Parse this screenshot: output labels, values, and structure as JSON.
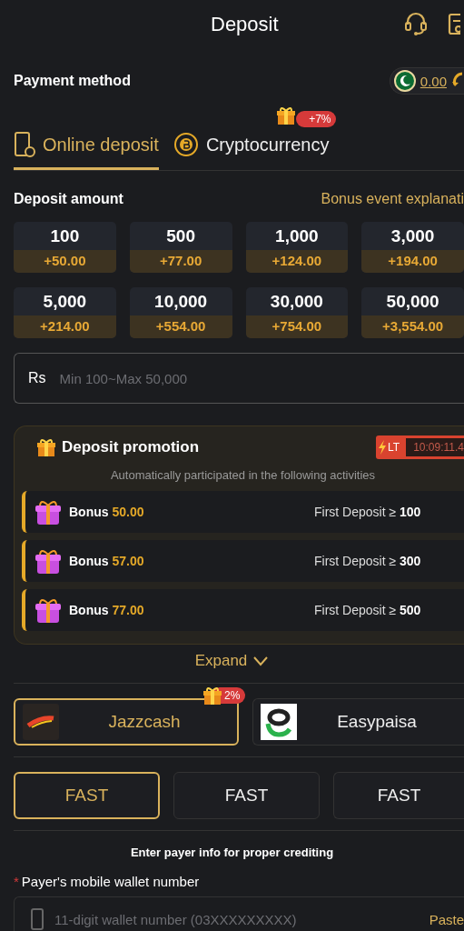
{
  "header": {
    "title": "Deposit"
  },
  "payment_method": {
    "label": "Payment method",
    "balance": "0.00"
  },
  "tabs": [
    {
      "label": "Online deposit",
      "selected": true,
      "kind": "phone"
    },
    {
      "label": "Cryptocurrency",
      "selected": false,
      "kind": "coin",
      "badge": "+7%"
    }
  ],
  "deposit_amount": {
    "label": "Deposit amount",
    "link": "Bonus event explanati",
    "amounts": [
      {
        "amount": "100",
        "bonus": "+50.00"
      },
      {
        "amount": "500",
        "bonus": "+77.00"
      },
      {
        "amount": "1,000",
        "bonus": "+124.00"
      },
      {
        "amount": "3,000",
        "bonus": "+194.00"
      },
      {
        "amount": "5,000",
        "bonus": "+214.00"
      },
      {
        "amount": "10,000",
        "bonus": "+554.00"
      },
      {
        "amount": "30,000",
        "bonus": "+754.00"
      },
      {
        "amount": "50,000",
        "bonus": "+3,554.00"
      }
    ],
    "currency": "Rs",
    "placeholder": "Min 100~Max 50,000"
  },
  "promotion": {
    "title": "Deposit promotion",
    "tag": "LT",
    "timer": "10:09:11.4",
    "note": "Automatically participated in the following activities",
    "items": [
      {
        "label": "Bonus",
        "amount": "50.00",
        "condition": "First Deposit ≥",
        "threshold": "100"
      },
      {
        "label": "Bonus",
        "amount": "57.00",
        "condition": "First Deposit ≥",
        "threshold": "300"
      },
      {
        "label": "Bonus",
        "amount": "77.00",
        "condition": "First Deposit ≥",
        "threshold": "500"
      }
    ],
    "expand": "Expand"
  },
  "channels": [
    {
      "name": "Jazzcash",
      "selected": true,
      "kind": "jazz",
      "badge": "2%"
    },
    {
      "name": "Easypaisa",
      "selected": false,
      "kind": "easy"
    }
  ],
  "speeds": [
    {
      "label": "FAST",
      "selected": true
    },
    {
      "label": "FAST",
      "selected": false
    },
    {
      "label": "FAST",
      "selected": false
    }
  ],
  "payer": {
    "heading": "Enter payer info for proper crediting",
    "required_mark": "*",
    "label": "Payer's mobile wallet number",
    "placeholder": "11-digit wallet number (03XXXXXXXXX)",
    "paste": "Paste"
  }
}
